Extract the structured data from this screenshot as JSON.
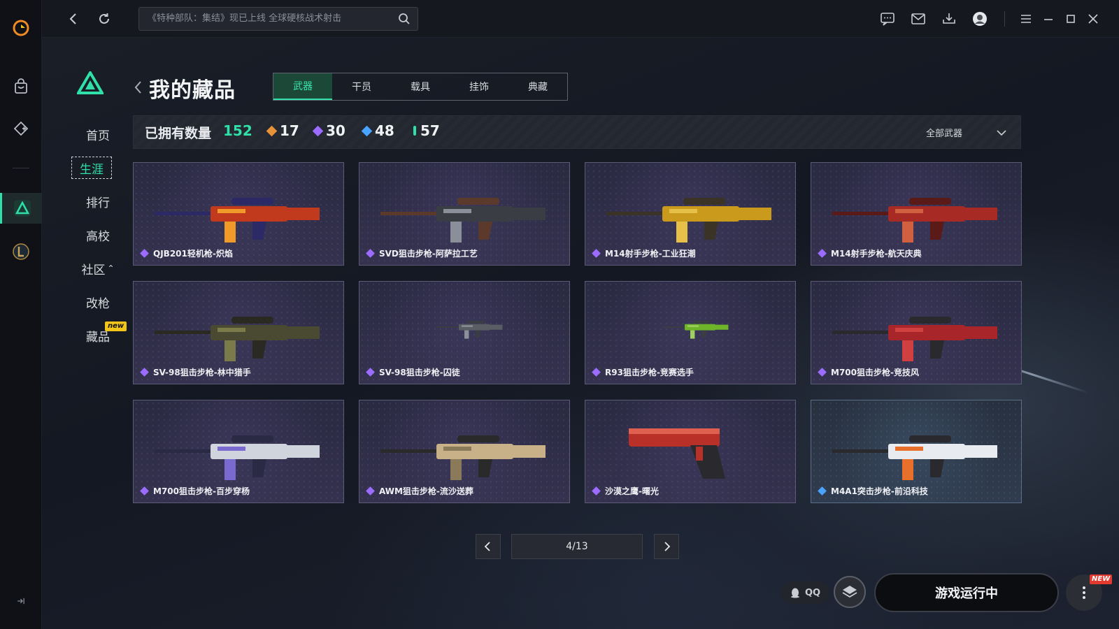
{
  "topbar": {
    "search_placeholder": "《特种部队：集结》现已上线 全球硬核战术射击"
  },
  "game_nav": {
    "items": [
      {
        "label": "首页"
      },
      {
        "label": "生涯"
      },
      {
        "label": "排行"
      },
      {
        "label": "高校"
      },
      {
        "label": "社区"
      },
      {
        "label": "改枪"
      },
      {
        "label": "藏品"
      }
    ],
    "community_caret": "⌃",
    "new_badge": "new"
  },
  "header": {
    "title": "我的藏品",
    "tabs": [
      {
        "label": "武器"
      },
      {
        "label": "干员"
      },
      {
        "label": "载具"
      },
      {
        "label": "挂饰"
      },
      {
        "label": "典藏"
      }
    ]
  },
  "owned": {
    "label": "已拥有数量",
    "total": "152",
    "stats": [
      {
        "value": "17",
        "color": "#e8923a"
      },
      {
        "value": "30",
        "color": "#9b6cff"
      },
      {
        "value": "48",
        "color": "#4aa3ff"
      },
      {
        "value": "57",
        "color": "#2fe0a8"
      }
    ],
    "filter": "全部武器"
  },
  "cards": [
    {
      "name": "QJB201轻机枪-炽焰",
      "rarity": "purple"
    },
    {
      "name": "SVD狙击步枪-阿萨拉工艺",
      "rarity": "purple"
    },
    {
      "name": "M14射手步枪-工业狂潮",
      "rarity": "purple"
    },
    {
      "name": "M14射手步枪-航天庆典",
      "rarity": "purple"
    },
    {
      "name": "SV-98狙击步枪-林中猎手",
      "rarity": "purple"
    },
    {
      "name": "SV-98狙击步枪-囚徒",
      "rarity": "purple"
    },
    {
      "name": "R93狙击步枪-竞赛选手",
      "rarity": "purple"
    },
    {
      "name": "M700狙击步枪-竞技风",
      "rarity": "purple"
    },
    {
      "name": "M700狙击步枪-百步穿杨",
      "rarity": "purple"
    },
    {
      "name": "AWM狙击步枪-流沙送葬",
      "rarity": "purple"
    },
    {
      "name": "沙漠之鹰-曙光",
      "rarity": "purple"
    },
    {
      "name": "M4A1突击步枪-前沿科技",
      "rarity": "blue"
    }
  ],
  "pagination": {
    "page": "4/13"
  },
  "bottom": {
    "qq_label": "QQ",
    "run_label": "游戏运行中",
    "new_tag": "NEW"
  },
  "colors": {
    "accent": "#2fe0a8",
    "purple": "#9b6cff",
    "blue": "#4aa3ff"
  }
}
